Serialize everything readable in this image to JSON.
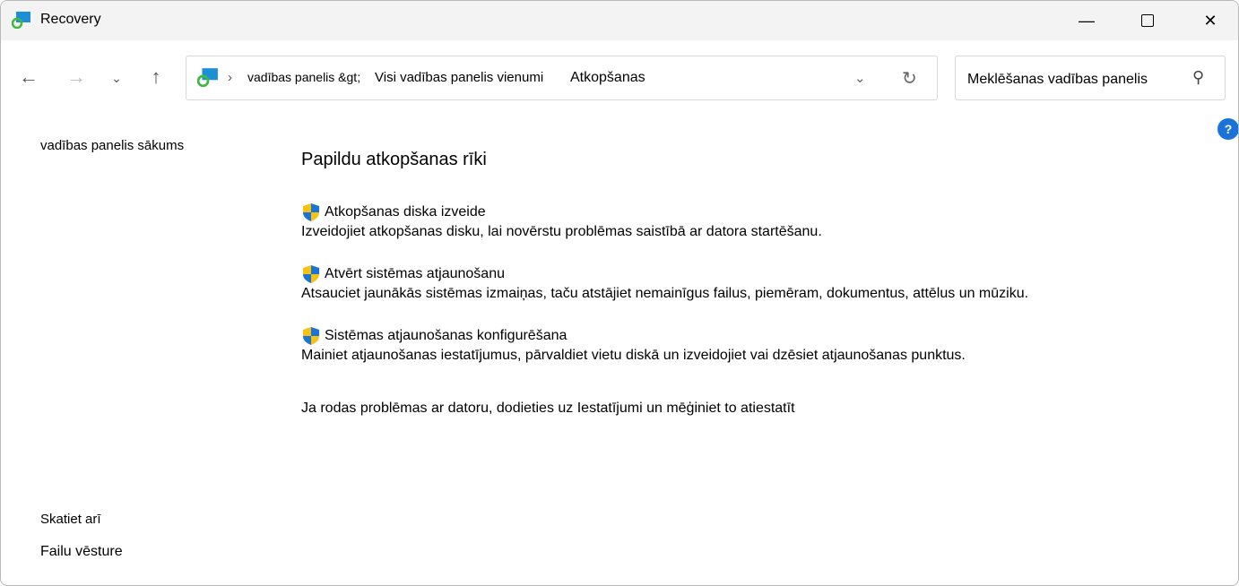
{
  "window": {
    "title": "Recovery"
  },
  "address": {
    "crumbs": [
      "vadības panelis &gt;",
      "Visi vadības panelis vienumi",
      "Atkopšanas"
    ]
  },
  "search": {
    "placeholder": "Meklēšanas vadības panelis"
  },
  "sidebar": {
    "home": "vadības panelis sākums",
    "see_also": "Skatiet arī",
    "file_history": "Failu vēsture"
  },
  "main": {
    "heading": "Papildu atkopšanas rīki",
    "items": [
      {
        "title": "Atkopšanas diska izveide",
        "desc": "Izveidojiet atkopšanas disku, lai novērstu problēmas saistībā ar datora startēšanu."
      },
      {
        "title": "Atvērt sistēmas atjaunošanu",
        "desc": "Atsauciet jaunākās sistēmas izmaiņas, taču atstājiet nemainīgus failus, piemēram, dokumentus, attēlus un mūziku."
      },
      {
        "title": "Sistēmas atjaunošanas konfigurēšana",
        "desc": "Mainiet atjaunošanas iestatījumus, pārvaldiet vietu diskā un izveidojiet vai dzēsiet atjaunošanas punktus."
      }
    ],
    "note": "Ja rodas problēmas ar datoru, dodieties uz Iestatījumi un mēģiniet to atiestatīt"
  },
  "help": "?"
}
